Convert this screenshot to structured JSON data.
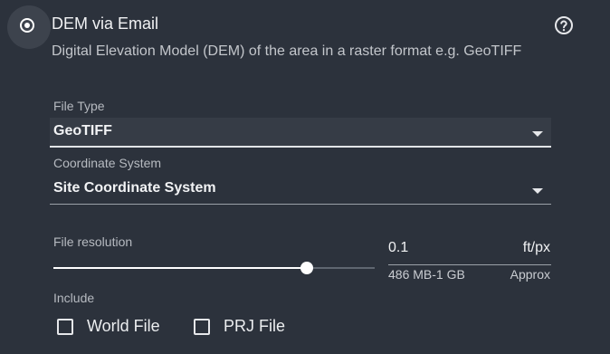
{
  "option": {
    "title": "DEM via Email",
    "selected": true,
    "description": "Digital Elevation Model (DEM) of the area in a raster format e.g. GeoTIFF",
    "help_icon": "help-circle-icon"
  },
  "file_type": {
    "label": "File Type",
    "value": "GeoTIFF"
  },
  "coordinate_system": {
    "label": "Coordinate System",
    "value": "Site Coordinate System"
  },
  "file_resolution": {
    "label": "File resolution",
    "value": "0.1",
    "unit": "ft/px",
    "size_range": "486 MB-1 GB",
    "size_note": "Approx",
    "slider_level": 0.79
  },
  "include": {
    "label": "Include",
    "options": [
      {
        "label": "World File",
        "checked": false
      },
      {
        "label": "PRJ File",
        "checked": false
      }
    ]
  },
  "colors": {
    "background": "#2c323c",
    "selected_field_background": "#363c46",
    "text": "#e6e7ea",
    "muted_text": "#b6bac0"
  }
}
